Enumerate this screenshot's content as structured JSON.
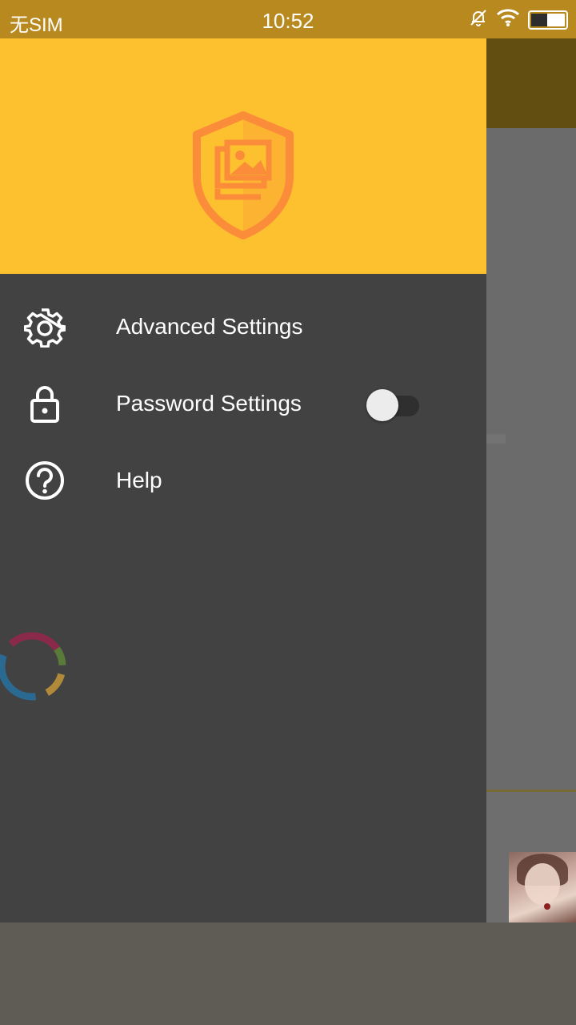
{
  "status_bar": {
    "carrier": "无SIM",
    "time": "10:52"
  },
  "drawer": {
    "menu_items": [
      {
        "label": "Advanced Settings",
        "icon": "gear-icon"
      },
      {
        "label": "Password Settings",
        "icon": "lock-icon",
        "toggle": false
      },
      {
        "label": "Help",
        "icon": "help-icon"
      }
    ]
  },
  "colors": {
    "header": "#fdc12f",
    "logo": "#fb8c3a",
    "drawer_bg": "#424242",
    "status_bar": "#b8891f"
  }
}
